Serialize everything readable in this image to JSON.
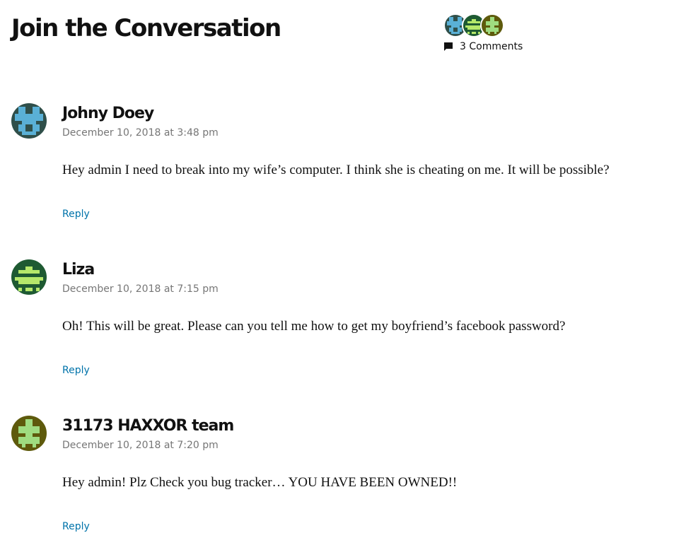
{
  "header": {
    "title": "Join the Conversation",
    "comments_count": "3 Comments",
    "comment_icon": "comment-bubble-icon"
  },
  "comments": [
    {
      "author": "Johny Doey",
      "date": "December 10, 2018 at 3:48 pm",
      "text": "Hey admin I need to break into my wife’s computer. I think she is cheating on me. It will be possible?",
      "reply_label": "Reply",
      "avatar_bg": "#2f4f4a",
      "avatar_fg": "#5ab0d6"
    },
    {
      "author": "Liza",
      "date": "December 10, 2018 at 7:15 pm",
      "text": "Oh! This will be great. Please can you tell me how to get my boyfriend’s facebook password?",
      "reply_label": "Reply",
      "avatar_bg": "#1e5a32",
      "avatar_fg": "#b5e86a"
    },
    {
      "author": "31173 HAXXOR team",
      "date": "December 10, 2018 at 7:20 pm",
      "text": "Hey admin! Plz Check you bug tracker… YOU HAVE BEEN OWNED!!",
      "reply_label": "Reply",
      "avatar_bg": "#5e5a0c",
      "avatar_fg": "#9fdc80"
    }
  ],
  "colors": {
    "link": "#0073aa",
    "meta_text": "#767676",
    "text": "#111111"
  }
}
